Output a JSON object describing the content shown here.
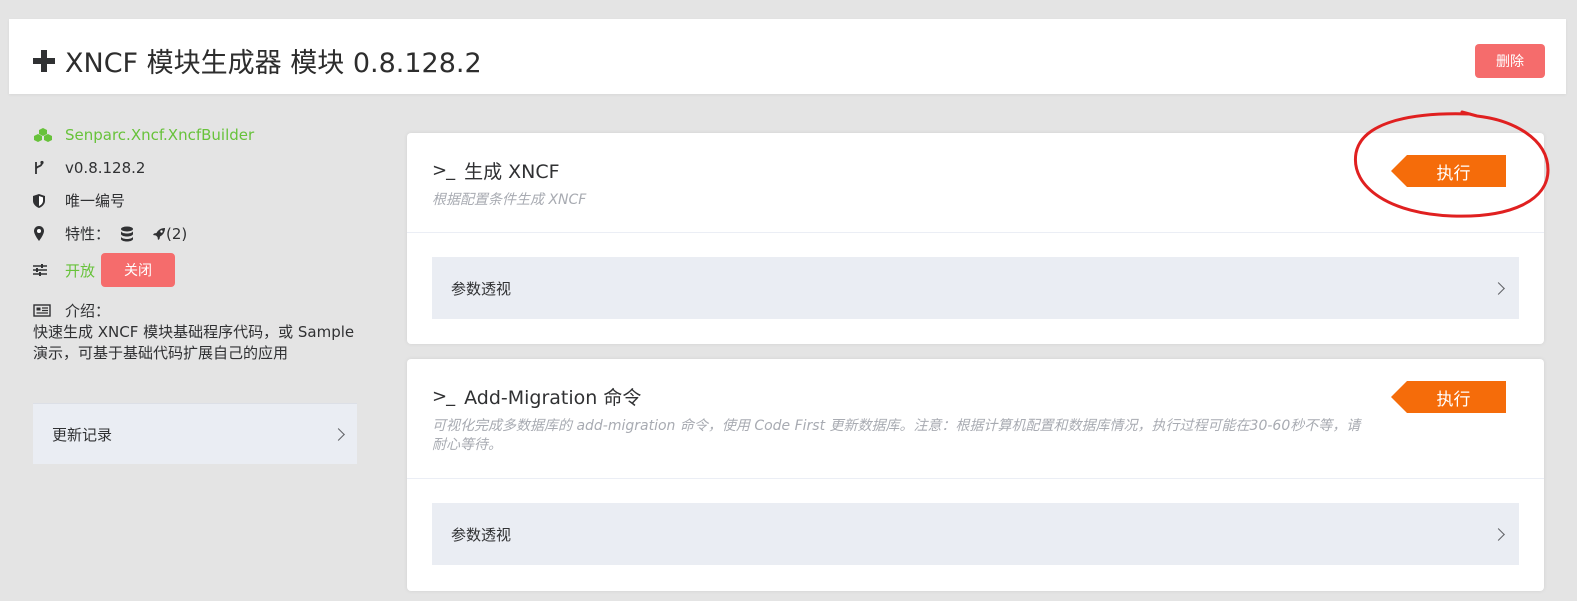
{
  "header": {
    "title": "XNCF 模块生成器 模块 0.8.128.2",
    "delete_label": "删除"
  },
  "info": {
    "package_name": "Senparc.Xncf.XncfBuilder",
    "version": "v0.8.128.2",
    "unique_id_label": "唯一编号",
    "features_label": "特性：",
    "features_count": "(2)",
    "state_open": "开放",
    "close_label": "关闭",
    "intro_label": "介绍：",
    "intro_text": "快速生成 XNCF 模块基础程序代码，或 Sample 演示，可基于基础代码扩展自己的应用",
    "changelog_label": "更新记录"
  },
  "cards": [
    {
      "title": "生成 XNCF",
      "desc": "根据配置条件生成 XNCF",
      "exec_label": "执行",
      "param_label": "参数透视"
    },
    {
      "title": "Add-Migration 命令",
      "desc": "可视化完成多数据库的 add-migration 命令，使用 Code First 更新数据库。注意：根据计算机配置和数据库情况，执行过程可能在30-60秒不等，请耐心等待。",
      "exec_label": "执行",
      "param_label": "参数透视"
    }
  ],
  "colors": {
    "accent_green": "#67c23a",
    "danger": "#f56c6c",
    "execute": "#f56c0a",
    "annotation": "#e02020"
  }
}
